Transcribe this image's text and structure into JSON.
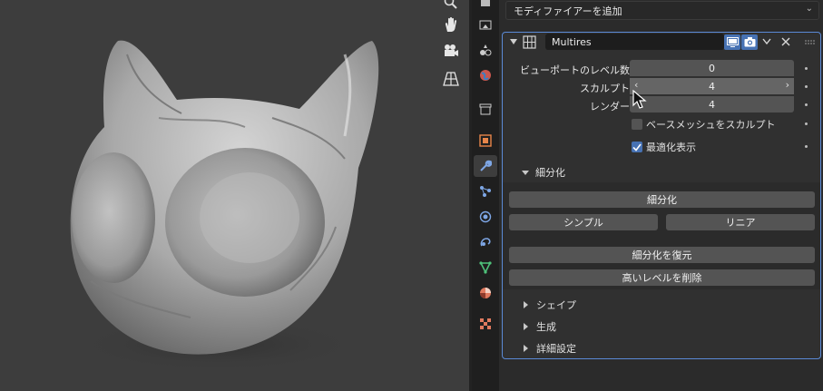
{
  "add_modifier_label": "モディファイアーを追加",
  "modifier": {
    "name": "Multires",
    "rows": [
      {
        "label": "ビューポートのレベル数",
        "value": "0"
      },
      {
        "label": "スカルプト",
        "value": "4"
      },
      {
        "label": "レンダー",
        "value": "4"
      }
    ],
    "checks": [
      {
        "label": "ベースメッシュをスカルプト",
        "checked": false
      },
      {
        "label": "最適化表示",
        "checked": true
      }
    ],
    "subdivide": {
      "header": "細分化",
      "subdivide_btn": "細分化",
      "simple_btn": "シンプル",
      "linear_btn": "リニア",
      "unsubdivide_btn": "細分化を復元",
      "delete_higher_btn": "高いレベルを削除"
    },
    "collapsed_sections": [
      "シェイプ",
      "生成",
      "詳細設定"
    ]
  },
  "colors": {
    "accent": "#4772b3",
    "selection_outline": "#5b8ad6"
  }
}
